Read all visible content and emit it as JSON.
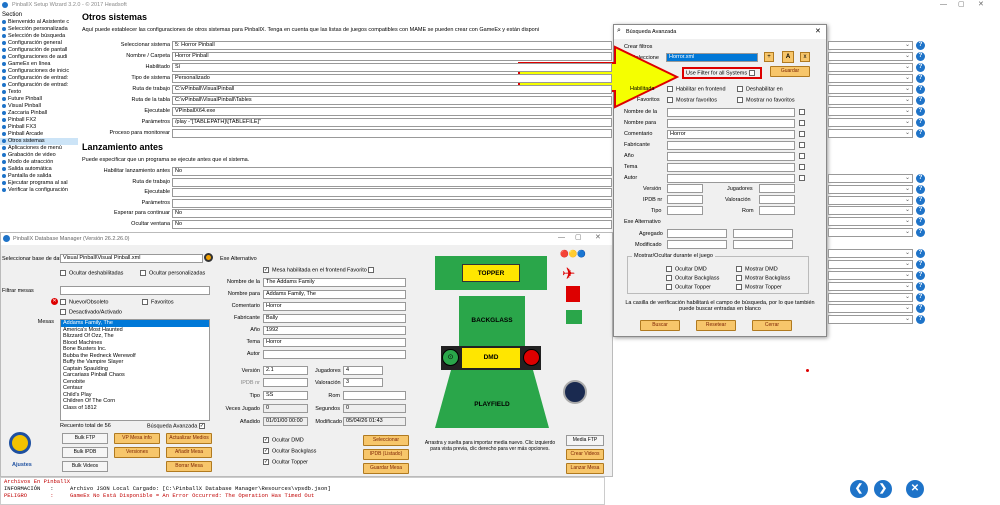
{
  "window": {
    "title": "PinballX Setup Wizard 3.2.0 - © 2017 Headsoft"
  },
  "sidebar": {
    "section": "Section",
    "items": [
      {
        "label": "Bienvenido al Asistente c"
      },
      {
        "label": "Selección personalizada"
      },
      {
        "label": "Selección de búsqueda"
      },
      {
        "label": "Configuración general"
      },
      {
        "label": "Configuración de pantall"
      },
      {
        "label": "Configuraciones de audi"
      },
      {
        "label": "GameEx en línea"
      },
      {
        "label": "Configuraciones de inicic"
      },
      {
        "label": "Configuración de entrad:"
      },
      {
        "label": "Configuración de entrad:"
      },
      {
        "label": "Texto"
      },
      {
        "label": "Future Pinball"
      },
      {
        "label": "Visual Pinball"
      },
      {
        "label": "Zaccaria Pinball"
      },
      {
        "label": "Pinball FX2"
      },
      {
        "label": "Pinball FX3"
      },
      {
        "label": "Pinball Arcade"
      },
      {
        "label": "Otros sistemas"
      },
      {
        "label": "Aplicaciones de menú"
      },
      {
        "label": "Grabación de video"
      },
      {
        "label": "Modo de atracción"
      },
      {
        "label": "Salida automática"
      },
      {
        "label": "Pantalla de salida"
      },
      {
        "label": "Ejecutar programa al sal"
      },
      {
        "label": "Verificar la configuración"
      }
    ]
  },
  "other": {
    "title": "Otros sistemas",
    "desc": "Aquí puede establecer las configuraciones de otros sistemas para PinballX. Tenga en cuenta que las listas de juegos compatibles con MAME se pueden crear con GameEx y están disponi",
    "rows": [
      {
        "label": "Seleccionar sistema",
        "value": "5: Horror Pinball"
      },
      {
        "label": "Nombre / Carpeta",
        "value": "Horror Pinball"
      },
      {
        "label": "Habilitado",
        "value": "Sí"
      },
      {
        "label": "Tipo de sistema",
        "value": "Personalizado"
      },
      {
        "label": "Ruta de trabajo",
        "value": "C:\\vPinball\\VisualPinball"
      },
      {
        "label": "Ruta de la tabla",
        "value": "C:\\vPinball\\VisualPinball\\Tables"
      },
      {
        "label": "Ejecutable",
        "value": "VPinballX64.exe"
      },
      {
        "label": "Parámetros",
        "value": "/play -\"[TABLEPATH]\\[TABLEFILE]\""
      },
      {
        "label": "Proceso para monitorear",
        "value": ""
      }
    ],
    "launch_title": "Lanzamiento antes",
    "launch_desc": "Puede especificar que un programa se ejecute antes que el sistema.",
    "launch_rows": [
      {
        "label": "Habilitar lanzamiento antes",
        "value": "No"
      },
      {
        "label": "Ruta de trabajo",
        "value": ""
      },
      {
        "label": "Ejecutable",
        "value": ""
      },
      {
        "label": "Parámetros",
        "value": ""
      },
      {
        "label": "Esperar para continuar",
        "value": "No"
      },
      {
        "label": "Ocultar ventana",
        "value": "No"
      }
    ]
  },
  "dbm": {
    "title": "PinballX Database Manager (Versión 26.2.26.0)",
    "db_label": "Seleccionar base de datos",
    "db_value": "Visual Pinball\\Visual Pinball.xml",
    "hide_disabled": "Ocultar deshabilitadas",
    "hide_custom": "Ocultar personalizadas",
    "filter_label": "Filtrar mesas",
    "new_old": "Nuevo/Obsoleto",
    "favorites": "Favoritos",
    "deact": "Desactivado/Activado",
    "tables_label": "Mesas",
    "tables": [
      "Addams Family, The",
      "America's Most Haunted",
      "Blizzard Of Ozz, The",
      "Blood Machines",
      "Bone Busters Inc.",
      "Bubba the Redneck Werewolf",
      "Buffy the Vampire Slayer",
      "Captain Spaulding",
      "Carcariass Pinball Chaos",
      "Cenobite",
      "Centaur",
      "Child's Play",
      "Children Of The Corn",
      "Class of 1812"
    ],
    "count": "Recuento total de 56",
    "adv_search": "Búsqueda Avanzada",
    "ajustes": "Ajustes",
    "btn_row1": [
      "Bulk FTP",
      "VP Mesa info",
      "Actualizar Medios"
    ],
    "btn_row2": [
      "Bulk IPDB",
      "Versiones",
      "Añadir Mesa"
    ],
    "btn_row3": [
      "Bulk Videos",
      "",
      "Borrar Mesa"
    ],
    "exe_alt": "Exe Alternativo",
    "mesa_hab": "Mesa habilitada en el frontend",
    "favorito": "Favorito",
    "fields": [
      {
        "label": "Nombre de la",
        "value": "The Addams Family"
      },
      {
        "label": "Nombre para",
        "value": "Addams Family, The"
      },
      {
        "label": "Comentario",
        "value": "Horror"
      },
      {
        "label": "Fabricante",
        "value": "Bally"
      },
      {
        "label": "Año",
        "value": "1992"
      },
      {
        "label": "Tema",
        "value": "Horror"
      },
      {
        "label": "Autor",
        "value": ""
      }
    ],
    "version_label": "Versión",
    "version": "2.1",
    "jugadores_label": "Jugadores",
    "jugadores": "4",
    "ipdb_label": "IPDB nr",
    "valoracion_label": "Valoración",
    "valoracion": "3",
    "tipo_label": "Tipo",
    "tipo": "SS",
    "rom_label": "Rom",
    "veces_label": "Veces Jugado",
    "veces": "0",
    "segundos_label": "Segundos",
    "segundos": "0",
    "anadido_label": "Añadido",
    "anadido": "01/01/00 00:00",
    "modificado_label": "Modificado",
    "modificado": "05/04/26 01:43",
    "hide_dmd": "Ocultar DMD",
    "hide_backglass": "Ocultar Backglass",
    "hide_topper": "Ocultar Topper",
    "btn_sel": "Seleccionar",
    "btn_ipdb": "IPDB (Listado)",
    "btn_guardar": "Guardar Mesa",
    "cab_topper": "TOPPER",
    "cab_backglass": "BACKGLASS",
    "cab_dmd": "DMD",
    "cab_playfield": "PLAYFIELD",
    "drop_text": "Arrastra y suelta para importar media nuevo. Clic izquierdo para vista previa, clic derecho para ver más opciones.",
    "btn_media": "Media FTP",
    "btn_crear": "Crear Videos",
    "btn_lanzar": "Lanzar Mesa"
  },
  "log": {
    "lines": [
      {
        "text": "Archivos En PinballX",
        "color": "#c00000"
      },
      {
        "text": "INFORMACIÓN   :     Archivo JSON Local Cargado: [C:\\PinballX Database Manager\\Resources\\vpsdb.json]",
        "color": "#000000"
      },
      {
        "text": "PELIGRO       :     GameEx No Está Disponible = An Error Occurred: The Operation Has Timed Out",
        "color": "#c00000"
      }
    ]
  },
  "dialog": {
    "title": "Búsqueda Avanzada",
    "crear": "Crear filtros",
    "seleccione": "Seleccione",
    "filter_value": "Horror.xml",
    "use_all": "Use Filter for all Systems",
    "guardar": "Guardar",
    "habilitada": "Habilitada",
    "hab_frontend": "Habilitar en frontend",
    "deshab": "Deshabilitar en",
    "favoritos": "Favoritos",
    "mostrar_fav": "Mostrar favoritos",
    "mostrar_nofav": "Mostrar no favoritos",
    "rows": [
      "Nombre de la",
      "Nombre para",
      "Comentario",
      "Fabricante",
      "Año",
      "Tema",
      "Autor"
    ],
    "comentario": "Horror",
    "version": "Versión",
    "jugadores": "Jugadores",
    "ipdb": "IPDB nr",
    "valoracion": "Valoración",
    "tipo": "Tipo",
    "rom": "Rom",
    "exe_alt": "Exe Alternativo",
    "agregado": "Agregado",
    "modificado": "Modificado",
    "group": "Mostrar/Ocultar durante el juego",
    "oc": [
      "Ocultar DMD",
      "Ocultar Backglass",
      "Ocultar Topper"
    ],
    "mo": [
      "Mostrar DMD",
      "Mostrar Backglass",
      "Mostrar Topper"
    ],
    "note": "La casilla de verificación habilitará el campo de búsqueda, por lo que también puede buscar entradas en blanco",
    "buscar": "Buscar",
    "resetear": "Resetear",
    "cerrar": "Cerrar"
  },
  "accent": "#1e73c8"
}
